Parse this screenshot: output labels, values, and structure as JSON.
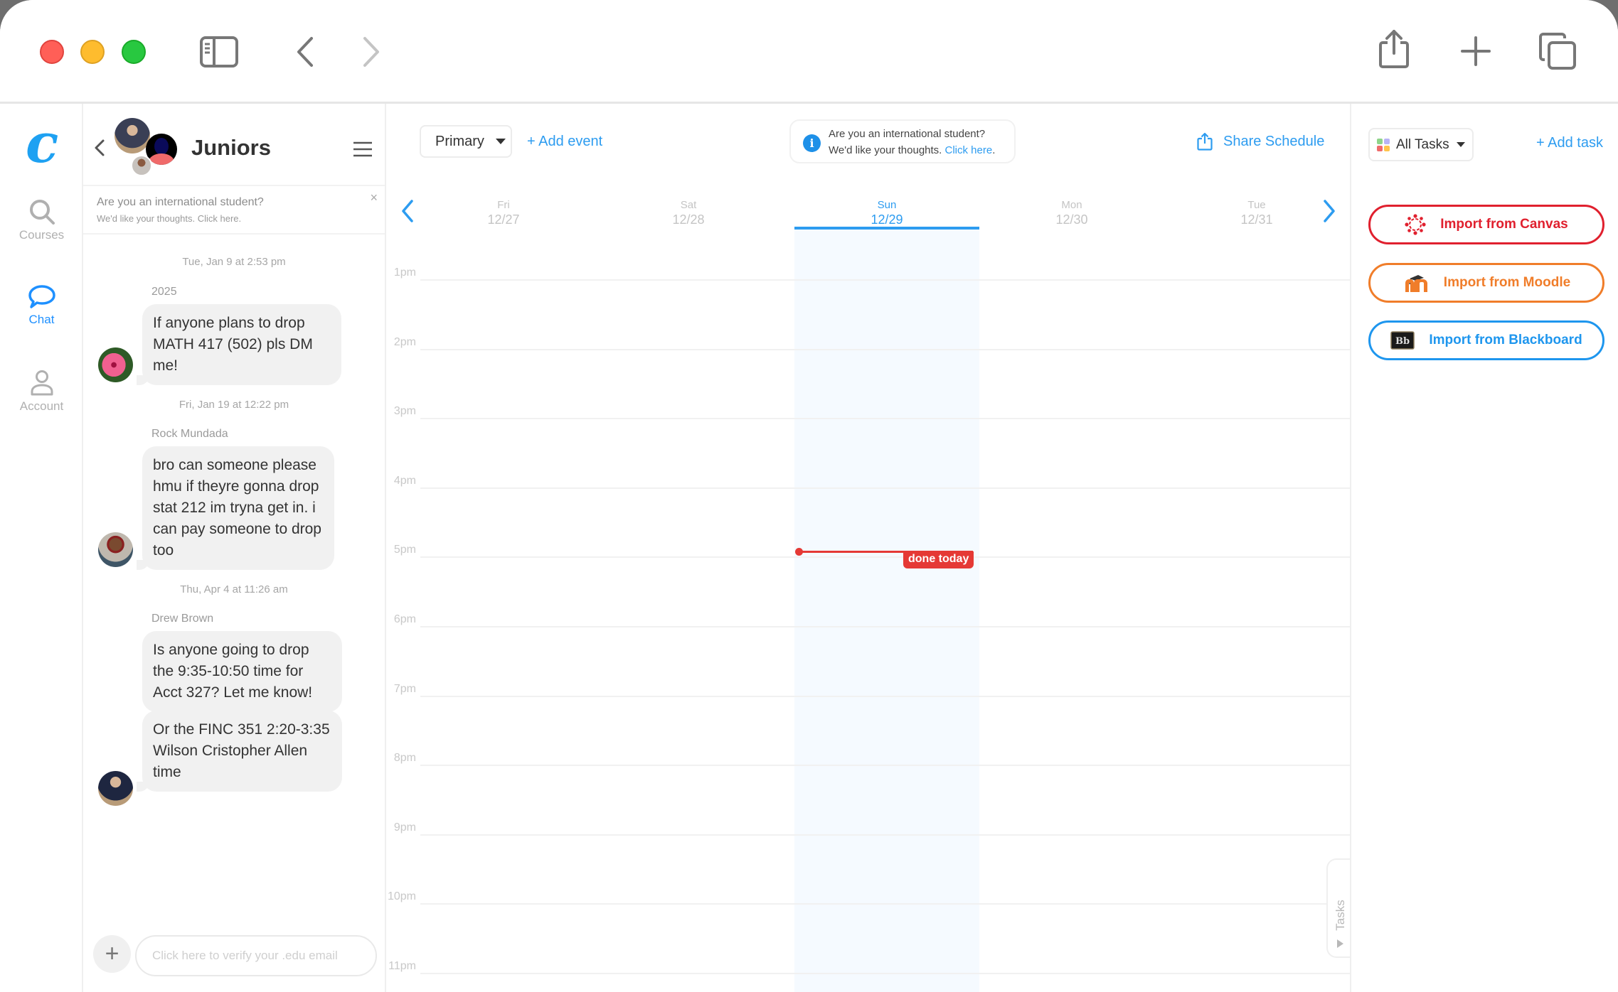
{
  "window": {
    "toolbar": {
      "sidebar_toggle_icon": "sidebar-icon",
      "back_icon": "chevron-left-icon",
      "forward_icon": "chevron-right-icon",
      "share_icon": "share-icon",
      "new_tab_icon": "plus-icon",
      "tabs_icon": "tabs-overview-icon"
    }
  },
  "leftnav": {
    "logo": "c",
    "items": [
      {
        "label": "Courses",
        "icon": "search-icon",
        "active": false
      },
      {
        "label": "Chat",
        "icon": "chat-bubble-icon",
        "active": true
      },
      {
        "label": "Account",
        "icon": "person-icon",
        "active": false
      }
    ]
  },
  "chat": {
    "title": "Juniors",
    "banner": {
      "line1": "Are you an international student?",
      "line2": "We'd like your thoughts. Click here.",
      "close": "×"
    },
    "messages": [
      {
        "timestamp": "Tue, Jan 9 at 2:53 pm",
        "sender": "2025",
        "bubbles": [
          "If anyone plans to drop MATH 417 (502) pls DM me!"
        ]
      },
      {
        "timestamp": "Fri, Jan 19 at 12:22 pm",
        "sender": "Rock Mundada",
        "bubbles": [
          "bro can someone please hmu if theyre gonna drop stat 212 im tryna get in. i can pay someone to drop too"
        ]
      },
      {
        "timestamp": "Thu, Apr 4 at 11:26 am",
        "sender": "Drew Brown",
        "bubbles": [
          "Is anyone going to drop the 9:35-10:50 time for Acct 327? Let me know!",
          "Or the FINC 351 2:20-3:35 Wilson Cristopher Allen time"
        ]
      }
    ],
    "composer": {
      "plus": "+",
      "placeholder": "Click here to verify your .edu email",
      "value": ""
    }
  },
  "calendar": {
    "calendar_select": "Primary",
    "add_event": "+ Add event",
    "intl_card": {
      "line1": "Are you an international student?",
      "line2": "We'd like your thoughts.",
      "link": "Click here",
      "period": "."
    },
    "share_schedule": "Share Schedule",
    "days": [
      {
        "name": "Fri",
        "date": "12/27",
        "active": false
      },
      {
        "name": "Sat",
        "date": "12/28",
        "active": false
      },
      {
        "name": "Sun",
        "date": "12/29",
        "active": true
      },
      {
        "name": "Mon",
        "date": "12/30",
        "active": false
      },
      {
        "name": "Tue",
        "date": "12/31",
        "active": false
      }
    ],
    "hours": [
      "1pm",
      "2pm",
      "3pm",
      "4pm",
      "5pm",
      "6pm",
      "7pm",
      "8pm",
      "9pm",
      "10pm",
      "11pm"
    ],
    "now_marker": {
      "label": "done today",
      "time_hours_after_first": 4.0
    },
    "tasks_tab": "Tasks"
  },
  "tasks": {
    "filter": "All Tasks",
    "add_task": "+ Add task",
    "imports": [
      {
        "label": "Import from Canvas",
        "color": "#e0202e",
        "icon": "canvas-logo-icon"
      },
      {
        "label": "Import from Moodle",
        "color": "#f07d2a",
        "icon": "moodle-logo-icon"
      },
      {
        "label": "Import from Blackboard",
        "color": "#1e96ee",
        "icon": "blackboard-logo-icon"
      }
    ]
  },
  "colors": {
    "accent": "#2d9cf0",
    "now_red": "#e53935",
    "today_bg": "#f5faff"
  }
}
